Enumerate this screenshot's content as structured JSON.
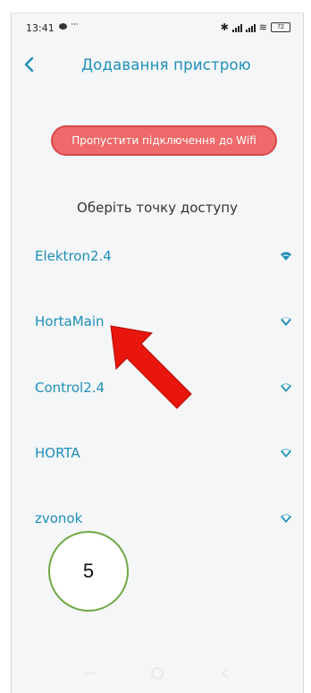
{
  "status_bar": {
    "time": "13:41",
    "more": "···",
    "bluetooth": "✱",
    "wifi": "≋",
    "battery": "72"
  },
  "header": {
    "title": "Додавання пристрою"
  },
  "skip_button_label": "Пропустити підключення до Wifi",
  "access_point_heading": "Оберіть точку доступу",
  "networks": [
    {
      "name": "Elektron2.4",
      "icon": "wifi-icon"
    },
    {
      "name": "HortaMain",
      "icon": "wifi-icon"
    },
    {
      "name": "Control2.4",
      "icon": "wifi-icon"
    },
    {
      "name": "HORTA",
      "icon": "wifi-icon"
    },
    {
      "name": "zvonok",
      "icon": "wifi-icon"
    }
  ],
  "annotation": {
    "step": "5",
    "arrow_color": "#e8160c",
    "circle_color": "#71a845"
  },
  "colors": {
    "accent": "#1f8fb8",
    "skip_button": "#ef6a6a"
  }
}
